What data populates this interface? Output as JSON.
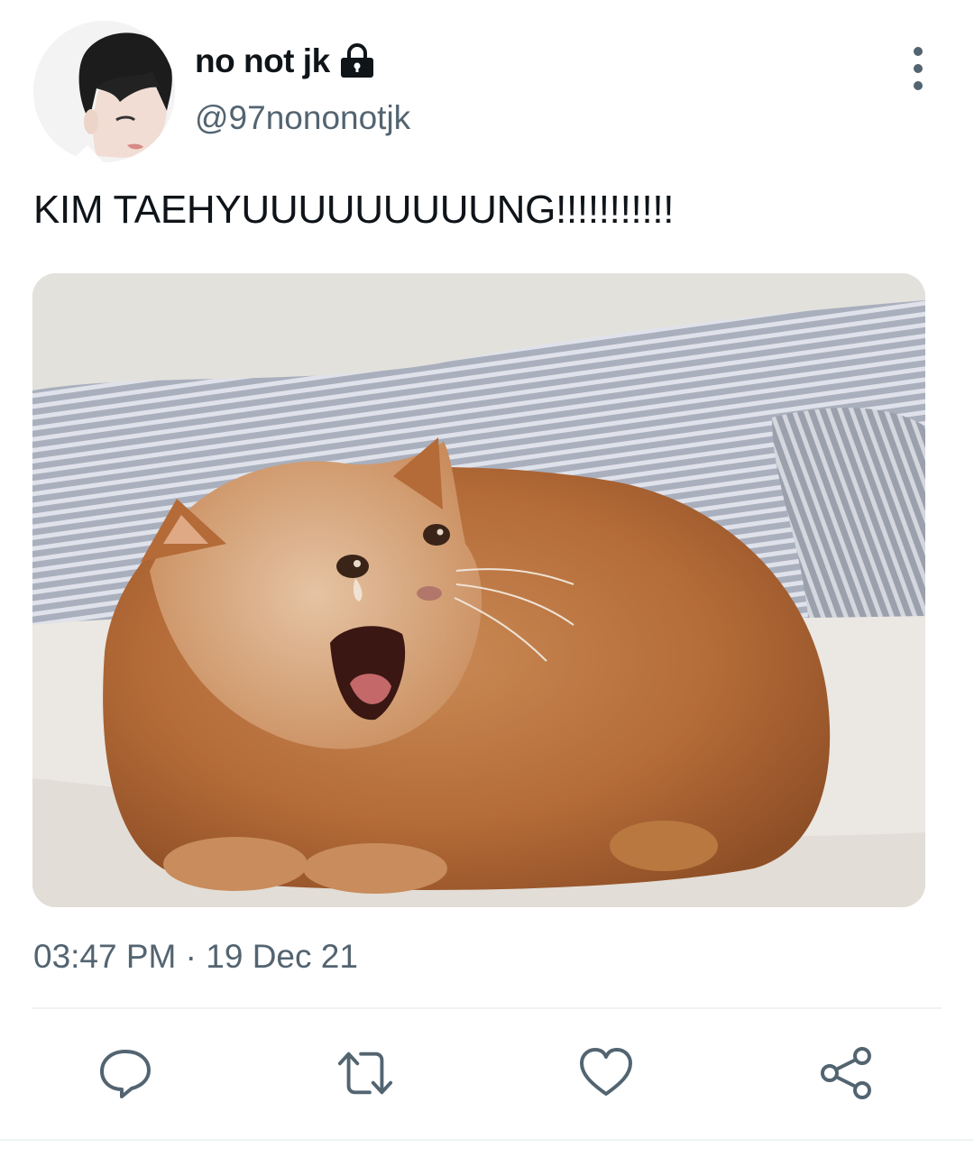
{
  "tweet": {
    "display_name": "no not jk",
    "handle": "@97nononotjk",
    "protected": true,
    "text": "KIM TAEHYUUUUUUUUUNG!!!!!!!!!!!",
    "time": "03:47 PM",
    "separator": " · ",
    "date": "19 Dec 21"
  },
  "icons": {
    "lock": "lock-icon",
    "more": "vertical-ellipsis-icon",
    "reply": "speech-bubble-icon",
    "retweet": "retweet-arrows-icon",
    "like": "heart-icon",
    "share": "share-nodes-icon"
  },
  "colors": {
    "text": "#0f1419",
    "secondary": "#536471",
    "divider": "#eff3f4"
  }
}
